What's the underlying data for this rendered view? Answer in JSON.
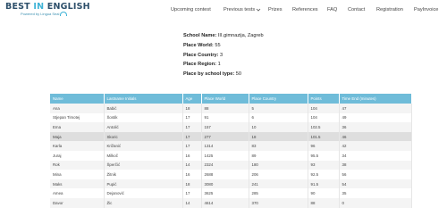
{
  "logo": {
    "text_main": "BEST",
    "text_in": " IN ",
    "text_english": "ENGLISH",
    "tagline": "Powered by Lingua Seal"
  },
  "nav": {
    "items": [
      {
        "label": "Upcoming contest"
      },
      {
        "label": "Previous tests"
      },
      {
        "label": "Prizes"
      },
      {
        "label": "References"
      },
      {
        "label": "FAQ"
      },
      {
        "label": "Contact"
      },
      {
        "label": "Registration"
      },
      {
        "label": "PayInvoice"
      }
    ]
  },
  "school": {
    "name_label": "School Name:",
    "name_value": "III.gimnazija, Zagreb",
    "world_label": "Place World:",
    "world_value": "55",
    "country_label": "Place Country:",
    "country_value": "3",
    "region_label": "Place Region:",
    "region_value": "1",
    "type_label": "Place by school type:",
    "type_value": "50"
  },
  "table": {
    "headers": [
      "Name",
      "Lastname Initials",
      "Age",
      "Place World",
      "Place Country",
      "Points",
      "Time End (minutes)"
    ],
    "rows": [
      [
        "Ana",
        "Babić",
        "18",
        "88",
        "5",
        "104",
        "47"
      ],
      [
        "Stjepan Timotej",
        "Šostik",
        "17",
        "91",
        "6",
        "104",
        "49"
      ],
      [
        "Ema",
        "Antolić",
        "17",
        "157",
        "10",
        "102.5",
        "36"
      ],
      [
        "Maja",
        "Skoric",
        "17",
        "277",
        "18",
        "101.5",
        "46"
      ],
      [
        "Karla",
        "Križanić",
        "17",
        "1314",
        "83",
        "96",
        "42"
      ],
      [
        "Juraj",
        "Milkoč",
        "16",
        "1425",
        "89",
        "95.5",
        "34"
      ],
      [
        "Rok",
        "Šperčić",
        "14",
        "2324",
        "180",
        "93",
        "38"
      ],
      [
        "Mina",
        "Žitnik",
        "16",
        "2688",
        "206",
        "92.5",
        "56"
      ],
      [
        "Maks",
        "Pupić",
        "18",
        "3080",
        "241",
        "91.5",
        "54"
      ],
      [
        "Amea",
        "Dejanović",
        "17",
        "3625",
        "285",
        "90",
        "35"
      ],
      [
        "Davor",
        "Žic",
        "14",
        "4614",
        "370",
        "88",
        "0"
      ]
    ]
  }
}
